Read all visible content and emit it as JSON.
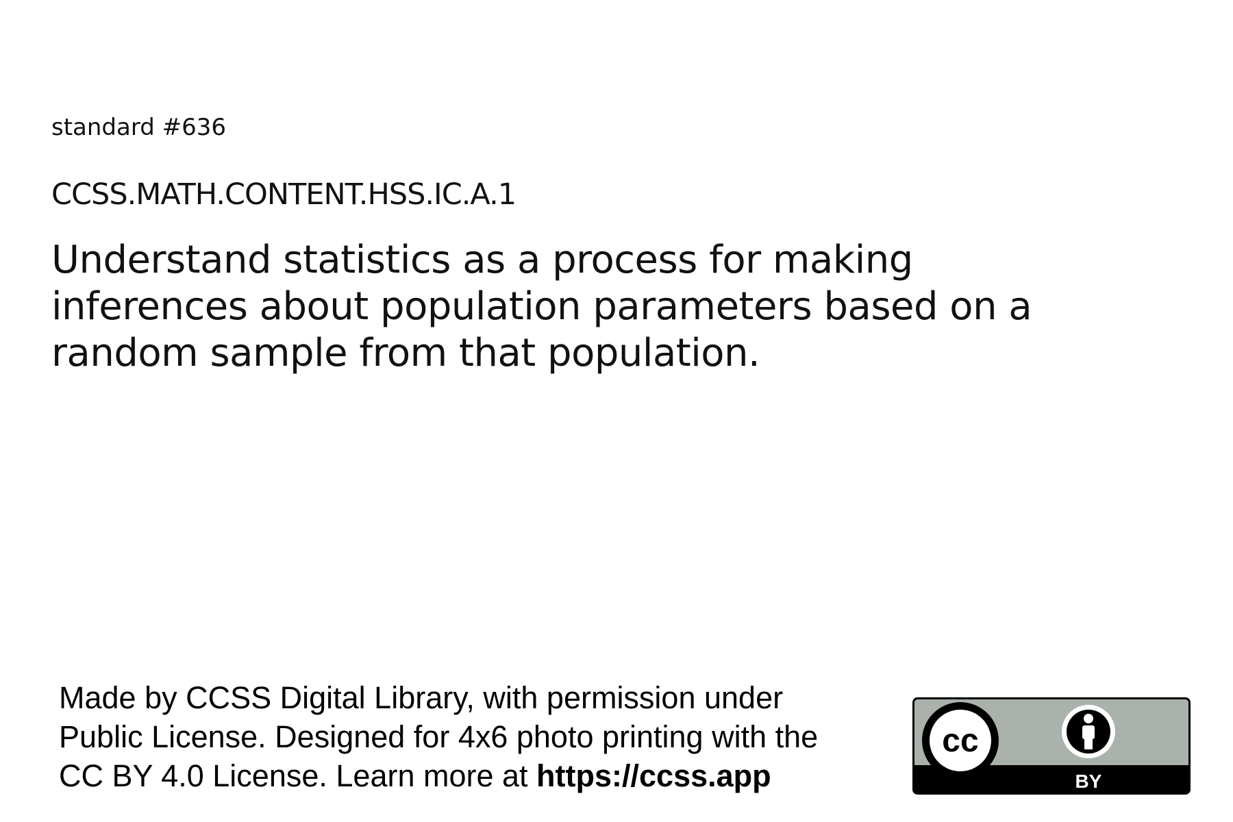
{
  "standard": {
    "number_label": "standard #636",
    "code": "CCSS.MATH.CONTENT.HSS.IC.A.1",
    "description_lines": [
      "Understand statistics as a process for making",
      "inferences about population parameters based on a",
      "random sample from that population."
    ]
  },
  "footer": {
    "line1": "Made by CCSS Digital Library, with permission under",
    "line2": "Public License. Designed for 4x6 photo printing with the",
    "line3_prefix": "CC BY 4.0 License. Learn more at ",
    "url": "https://ccss.app"
  },
  "license_badge": {
    "cc_mark": "cc",
    "by_label": "BY",
    "icon": "cc-by-license-icon",
    "colors": {
      "badge_gray": "#aab2ab",
      "badge_black": "#000000",
      "mark_white": "#ffffff"
    }
  }
}
